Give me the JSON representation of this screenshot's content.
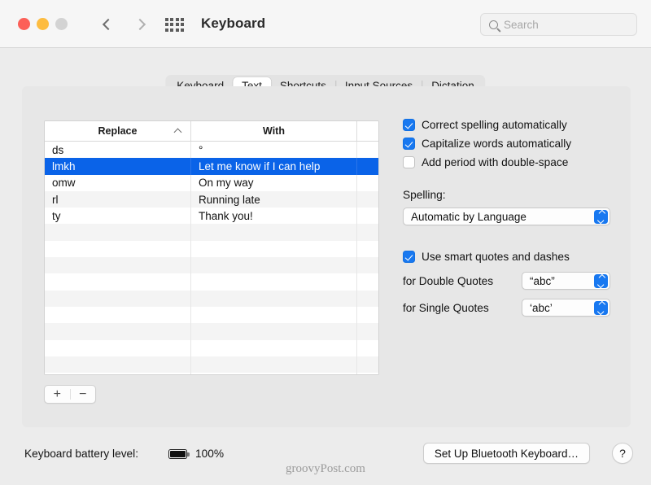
{
  "window": {
    "title": "Keyboard",
    "traffic_lights": [
      "close-red",
      "minimize-yellow",
      "zoom-gray"
    ],
    "nav": {
      "back_icon": "chevron-left-icon",
      "forward_icon": "chevron-right-icon"
    },
    "grid_icon": "show-all-grid-icon"
  },
  "search": {
    "placeholder": "Search",
    "value": "",
    "icon": "search-icon"
  },
  "tabs": [
    {
      "label": "Keyboard",
      "active": false
    },
    {
      "label": "Text",
      "active": true
    },
    {
      "label": "Shortcuts",
      "active": false
    },
    {
      "label": "Input Sources",
      "active": false
    },
    {
      "label": "Dictation",
      "active": false
    }
  ],
  "table": {
    "columns": [
      "Replace",
      "With",
      ""
    ],
    "sort": {
      "column": "Replace",
      "direction": "ascending",
      "icon": "chevron-up-icon"
    },
    "rows": [
      {
        "replace": "ds",
        "with": "°",
        "selected": false
      },
      {
        "replace": "lmkh",
        "with": "Let me know if I can help",
        "selected": true
      },
      {
        "replace": "omw",
        "with": "On my way",
        "selected": false
      },
      {
        "replace": "rl",
        "with": "Running late",
        "selected": false
      },
      {
        "replace": "ty",
        "with": "Thank you!",
        "selected": false
      }
    ],
    "selection_color": "#0a63e8"
  },
  "list_controls": {
    "add_label": "+",
    "remove_label": "−"
  },
  "options": {
    "checkboxes": [
      {
        "label": "Correct spelling automatically",
        "checked": true
      },
      {
        "label": "Capitalize words automatically",
        "checked": true
      },
      {
        "label": "Add period with double-space",
        "checked": false
      }
    ],
    "spelling_label": "Spelling:",
    "spelling_value": "Automatic by Language",
    "smart_quotes": {
      "label": "Use smart quotes and dashes",
      "checked": true
    },
    "double_quotes_label": "for Double Quotes",
    "double_quotes_value": "“abc”",
    "single_quotes_label": "for Single Quotes",
    "single_quotes_value": "‘abc’",
    "accent_color": "#1878f0"
  },
  "bottom": {
    "battery_label": "Keyboard battery level:",
    "battery_icon": "battery-full-icon",
    "battery_percent": "100%",
    "bluetooth_button": "Set Up Bluetooth Keyboard…",
    "help_button": "?",
    "watermark": "groovyPost.com"
  }
}
